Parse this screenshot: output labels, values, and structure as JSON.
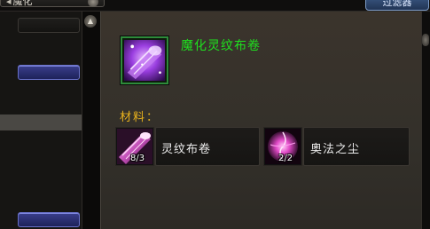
{
  "window": {
    "search_value": "魔化",
    "filter_button": "过滤器"
  },
  "recipe": {
    "name": "魔化灵纹布卷",
    "icon": "enchanted-runecloth-bolt-icon"
  },
  "materials": {
    "label": "材料：",
    "items": [
      {
        "name": "灵纹布卷",
        "count": "8/3",
        "icon": "runecloth-bolt-icon"
      },
      {
        "name": "奥法之尘",
        "count": "2/2",
        "icon": "arcane-dust-icon"
      }
    ]
  },
  "colors": {
    "recipe_name": "#1fe01f",
    "materials_label": "#e9b21c",
    "icon_border_uncommon": "#2e8b3a"
  }
}
